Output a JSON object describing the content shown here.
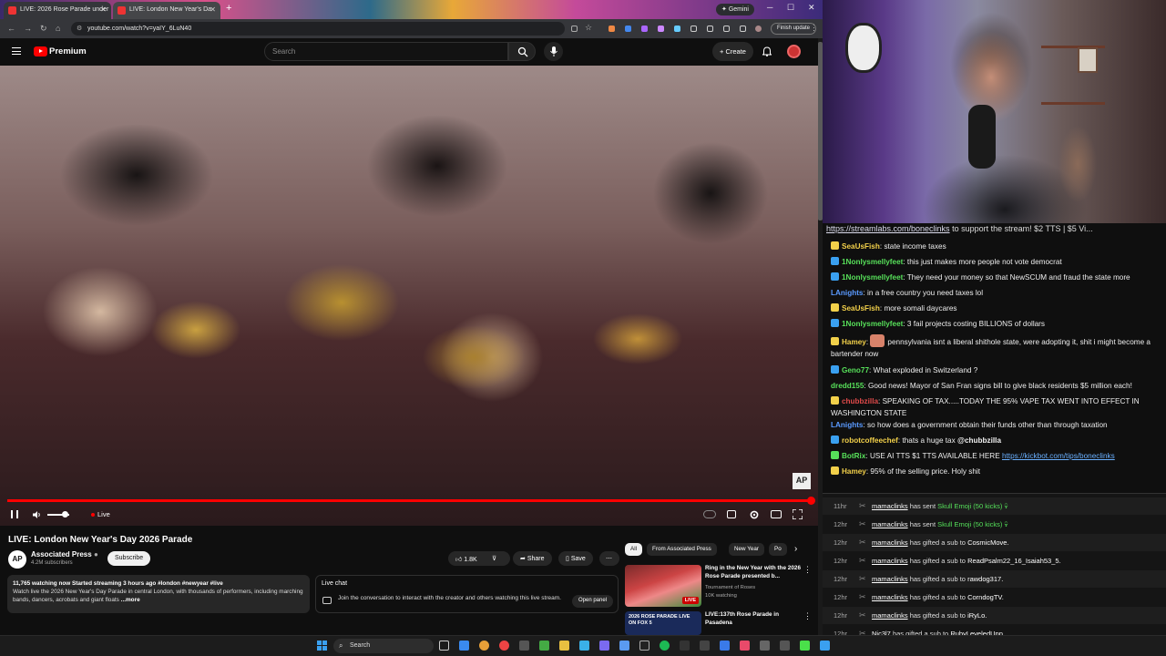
{
  "browser": {
    "tabs": [
      {
        "title": "LIVE: 2026 Rose Parade under"
      },
      {
        "title": "LIVE: London New Year's Da"
      }
    ],
    "gemini": "Gemini",
    "url": "youtube.com/watch?v=yaIY_6LuN40",
    "finish_update": "Finish update"
  },
  "youtube": {
    "brand": "Premium",
    "search_placeholder": "Search",
    "create": "Create",
    "player": {
      "live_label": "Live",
      "watermark": "AP",
      "progress_percent": 100,
      "volume_percent": 80
    },
    "video_title": "LIVE: London New Year's Day 2026 Parade",
    "channel": {
      "name": "Associated Press",
      "subs": "4.2M subscribers",
      "avatar_text": "AP"
    },
    "subscribe": "Subscribe",
    "likes": "1.8K",
    "share": "Share",
    "save": "Save",
    "description": {
      "meta": "11,765 watching now  Started streaming 3 hours ago  #london #newyear #live",
      "text": "Watch live the 2026 New Year's Day Parade in central London, with thousands of performers, including marching bands, dancers, acrobats and giant floats",
      "more": "...more"
    },
    "live_chat": {
      "title": "Live chat",
      "message": "Join the conversation to interact with the creator and others watching this live stream.",
      "button": "Open panel"
    },
    "chips": [
      "All",
      "From Associated Press",
      "New Year",
      "Po"
    ],
    "recommendations": [
      {
        "title": "Ring in the New Year with the 2026 Rose Parade presented b...",
        "channel": "Tournament of Roses",
        "meta": "10K watching",
        "badge": "LIVE"
      },
      {
        "title": "LIVE:137th Rose Parade in Pasadena",
        "thumb_text": "2026 ROSE PARADE LIVE ON FOX 5"
      }
    ]
  },
  "taskbar": {
    "search": "Search"
  },
  "stream": {
    "ribbon_link": "https://streamlabs.com/boneclinks",
    "ribbon_text": " to support the stream! $2 TTS | $5 Vi..."
  },
  "chat": [
    {
      "user": "SeaUsFish",
      "color": "#f2d04a",
      "text": "state income taxes"
    },
    {
      "user": "1Nonlysmellyfeet",
      "color": "#57e05a",
      "text": "this just makes more people not vote democrat"
    },
    {
      "user": "1Nonlysmellyfeet",
      "color": "#57e05a",
      "text": "They need your money so that NewSCUM and fraud the state more"
    },
    {
      "user": "LAnights",
      "color": "#5a9aff",
      "text": "in a free country you need taxes lol"
    },
    {
      "user": "SeaUsFish",
      "color": "#f2d04a",
      "text": "more somali daycares"
    },
    {
      "user": "1Nonlysmellyfeet",
      "color": "#57e05a",
      "text": "3 fail projects costing BILLIONS of dollars"
    },
    {
      "user": "Hamey",
      "color": "#f2d04a",
      "text": "pennsylvania isnt a liberal shithole state, were adopting it, shit i might become a bartender now"
    },
    {
      "user": "Geno77",
      "color": "#57e05a",
      "text": "What exploded in Switzerland ?"
    },
    {
      "user": "dredd155",
      "color": "#57e05a",
      "text": "Good news! Mayor of San Fran signs bill to give black residents $5 million each!"
    },
    {
      "user": "chubbzilla",
      "color": "#e04a4a",
      "text": "SPEAKING OF TAX.....TODAY THE 95% VAPE TAX WENT INTO EFFECT IN WASHINGTON STATE"
    },
    {
      "user": "LAnights",
      "color": "#5a9aff",
      "text": "so how does a government obtain their funds other than through taxation"
    },
    {
      "user": "robotcoffeechef",
      "color": "#f2d04a",
      "text": "thats a huge tax ",
      "mention": "@chubbzilla"
    },
    {
      "user": "BotRix",
      "color": "#57e05a",
      "text": "USE AI TTS $1 TTS AVAILABLE HERE ",
      "link": "https://kickbot.com/tips/boneclinks"
    },
    {
      "user": "Hamey",
      "color": "#f2d04a",
      "text": "95% of the selling price. Holy shit"
    }
  ],
  "events": [
    {
      "time": "11hr",
      "user": "mamaclinks",
      "action": "has sent ",
      "item": "Skull Emoji (50 kicks)"
    },
    {
      "time": "12hr",
      "user": "mamaclinks",
      "action": "has sent ",
      "item": "Skull Emoji (50 kicks)"
    },
    {
      "time": "12hr",
      "user": "mamaclinks",
      "action": "has gifted a sub to ",
      "target": "CosmicMove."
    },
    {
      "time": "12hr",
      "user": "mamaclinks",
      "action": "has gifted a sub to ",
      "target": "ReadPsalm22_16_Isaiah53_5."
    },
    {
      "time": "12hr",
      "user": "mamaclinks",
      "action": "has gifted a sub to ",
      "target": "rawdog317."
    },
    {
      "time": "12hr",
      "user": "mamaclinks",
      "action": "has gifted a sub to ",
      "target": "CorndogTV."
    },
    {
      "time": "12hr",
      "user": "mamaclinks",
      "action": "has gifted a sub to ",
      "target": "iRyLo."
    },
    {
      "time": "12hr",
      "user": "Nic3l7",
      "action": "has gifted a sub to ",
      "target": "RubyLeveledUpp."
    }
  ]
}
